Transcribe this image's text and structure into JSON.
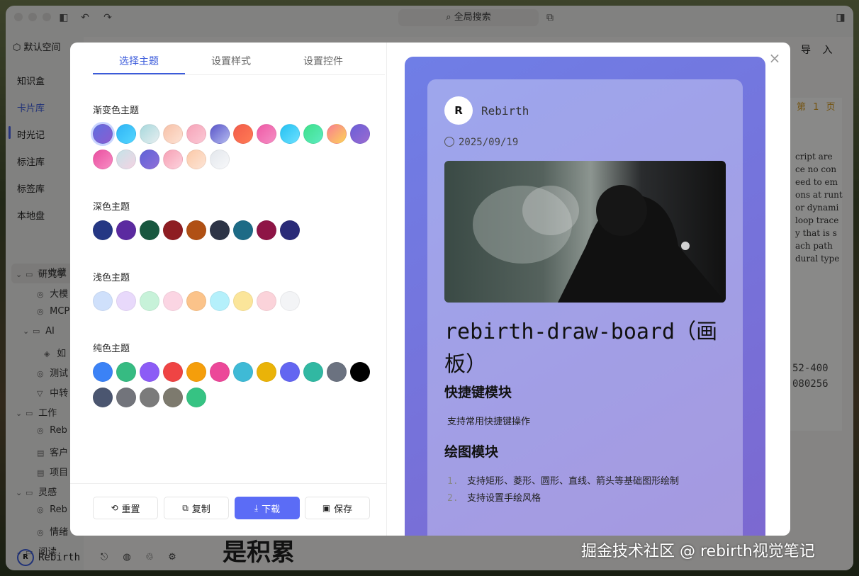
{
  "window": {
    "search_label": "全局搜索"
  },
  "sidebar": {
    "space_label": "默认空间",
    "nav": [
      {
        "label": "知识盒"
      },
      {
        "label": "卡片库"
      },
      {
        "label": "时光记"
      },
      {
        "label": "标注库"
      },
      {
        "label": "标签库"
      },
      {
        "label": "本地盘"
      }
    ],
    "favorites_label": "收藏",
    "tree": [
      {
        "label": "研究学",
        "icon": "folder-icon"
      },
      {
        "label": "大模",
        "icon": "note-icon"
      },
      {
        "label": "MCP",
        "icon": "note-icon"
      },
      {
        "label": "AI",
        "icon": "folder-icon"
      },
      {
        "label": "如",
        "icon": "note-icon"
      },
      {
        "label": "测试",
        "icon": "note-icon"
      },
      {
        "label": "中转",
        "icon": "note-icon"
      },
      {
        "label": "工作",
        "icon": "folder-icon"
      },
      {
        "label": "Reb",
        "icon": "note-icon"
      },
      {
        "label": "客户",
        "icon": "note-icon"
      },
      {
        "label": "项目",
        "icon": "note-icon"
      },
      {
        "label": "灵感",
        "icon": "folder-icon"
      },
      {
        "label": "Reb",
        "icon": "note-icon"
      },
      {
        "label": "情绪",
        "icon": "note-icon"
      },
      {
        "label": "阅读",
        "icon": "folder-icon"
      }
    ],
    "user_name": "Rebirth"
  },
  "background": {
    "import_label": "导 入",
    "page_label": "第 1 页",
    "doc_lines": [
      "cript are",
      "ce no con",
      "eed to em",
      "ons at runt",
      "or dynami",
      "loop trace",
      "y that is s",
      "ach path",
      "dural type"
    ],
    "numbers": [
      "52-400",
      "080256"
    ],
    "big_text": "是积累",
    "watermark": "掘金技术社区 @ rebirth视觉笔记"
  },
  "modal": {
    "tabs": [
      {
        "label": "选择主题"
      },
      {
        "label": "设置样式"
      },
      {
        "label": "设置控件"
      }
    ],
    "sections": {
      "gradient": {
        "title": "渐变色主题",
        "swatches": [
          [
            "#5f6fe0",
            "#8a5cd0"
          ],
          [
            "#2fb4f5",
            "#53d6ff"
          ],
          [
            "#a7d8dc",
            "#e6eef0"
          ],
          [
            "#f7c1a8",
            "#fde2d4"
          ],
          [
            "#f6a3b8",
            "#fbc8d5"
          ],
          [
            "#5a56c9",
            "#b3b9ef"
          ],
          [
            "#f25c4a",
            "#ff7b55"
          ],
          [
            "#ef5aa6",
            "#f58ec4"
          ],
          [
            "#25c1f2",
            "#6be0ff"
          ],
          [
            "#3fe08a",
            "#5cebc0"
          ],
          [
            "#f87f8f",
            "#fdd25a"
          ],
          [
            "#6b5fd8",
            "#9a6bd0"
          ],
          [
            "#ea4fa0",
            "#f78cc3"
          ],
          [
            "#c5e3e8",
            "#f4d3e3"
          ],
          [
            "#5f63d8",
            "#8e6fd8"
          ],
          [
            "#f7a1b5",
            "#fcd1dc"
          ],
          [
            "#fbc9a8",
            "#fde4d5"
          ],
          [
            "#e3e7ec",
            "#f7f8fa"
          ]
        ]
      },
      "dark": {
        "title": "深色主题",
        "swatches": [
          "#253784",
          "#5b2aa0",
          "#18573f",
          "#8e1d22",
          "#b05014",
          "#2d3446",
          "#1d6b86",
          "#8e1546",
          "#2a2b78"
        ]
      },
      "light": {
        "title": "浅色主题",
        "swatches": [
          "#cfe0fb",
          "#e8d9fb",
          "#c7f2d9",
          "#fbd5e3",
          "#fbc38a",
          "#b5f0fb",
          "#fbe59a",
          "#fbd3da",
          "#f3f4f6"
        ]
      },
      "solid": {
        "title": "纯色主题",
        "swatches": [
          "#3b82f6",
          "#36bb82",
          "#8c5cf6",
          "#ef4444",
          "#f59e0b",
          "#ec4899",
          "#3fbad6",
          "#eab308",
          "#6366f1",
          "#31b8a2",
          "#6b7280",
          "#000000",
          "#4b5670",
          "#72747b",
          "#7b7b7b",
          "#7d7a6e",
          "#36c383"
        ]
      }
    },
    "buttons": {
      "reset": "重置",
      "copy": "复制",
      "download": "下载",
      "save": "保存"
    },
    "preview": {
      "author": "Rebirth",
      "avatar_text": "R",
      "date": "2025/09/19",
      "title": "rebirth-draw-board（画板）",
      "section1_heading": "快捷键模块",
      "section1_text": "支持常用快捷键操作",
      "section2_heading": "绘图模块",
      "list": [
        {
          "num": "1.",
          "text": "支持矩形、菱形、圆形、直线、箭头等基础图形绘制"
        },
        {
          "num": "2.",
          "text": "支持设置手绘风格"
        }
      ]
    }
  }
}
